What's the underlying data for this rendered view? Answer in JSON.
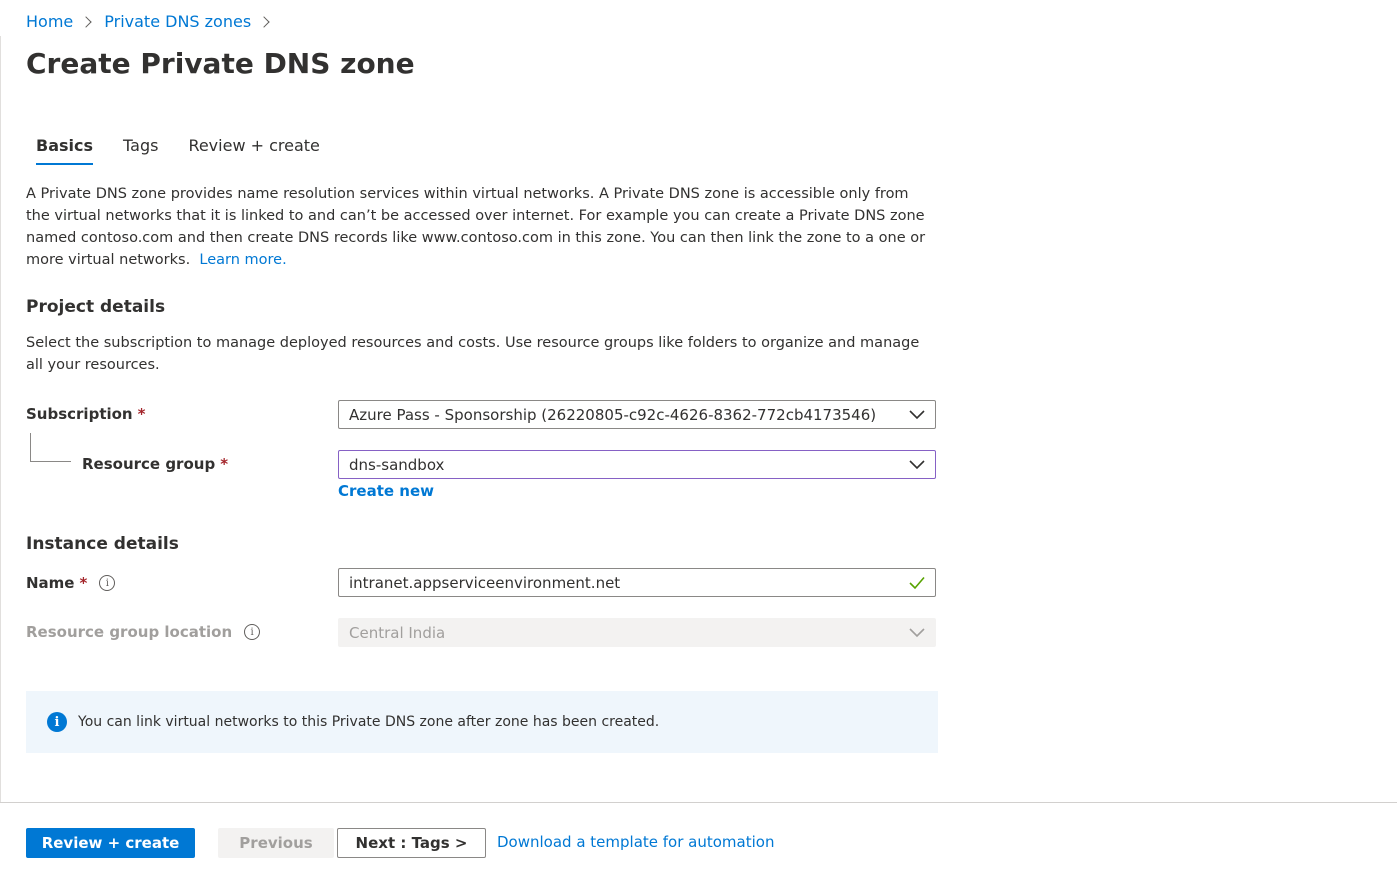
{
  "breadcrumb": {
    "home": "Home",
    "private_dns_zones": "Private DNS zones"
  },
  "page": {
    "title": "Create Private DNS zone"
  },
  "tabs": [
    {
      "label": "Basics",
      "active": true
    },
    {
      "label": "Tags",
      "active": false
    },
    {
      "label": "Review + create",
      "active": false
    }
  ],
  "intro": {
    "text": "A Private DNS zone provides name resolution services within virtual networks. A Private DNS zone is accessible only from the virtual networks that it is linked to and can’t be accessed over internet. For example you can create a Private DNS zone named contoso.com and then create DNS records like www.contoso.com in this zone. You can then link the zone to a one or more virtual networks.",
    "learn_more": "Learn more."
  },
  "project_details": {
    "heading": "Project details",
    "description": "Select the subscription to manage deployed resources and costs. Use resource groups like folders to organize and manage all your resources.",
    "subscription_label": "Subscription",
    "subscription_value": "Azure Pass - Sponsorship (26220805-c92c-4626-8362-772cb4173546)",
    "resource_group_label": "Resource group",
    "resource_group_value": "dns-sandbox",
    "create_new": "Create new",
    "required_marker": "*"
  },
  "instance_details": {
    "heading": "Instance details",
    "name_label": "Name",
    "name_value": "intranet.appserviceenvironment.net",
    "location_label": "Resource group location",
    "location_value": "Central India"
  },
  "info_box": {
    "text": "You can link virtual networks to this Private DNS zone after zone has been created."
  },
  "footer": {
    "review_create": "Review + create",
    "previous": "Previous",
    "next": "Next : Tags >",
    "download_template": "Download a template for automation"
  },
  "colors": {
    "accent": "#0078d4",
    "required": "#a4262c",
    "valid_check": "#57a300",
    "focus_border": "#8661c5"
  },
  "icons": {
    "breadcrumb_separator": "chevron-right-icon",
    "dropdown": "chevron-down-icon",
    "valid": "checkmark-icon",
    "info": "info-icon"
  }
}
